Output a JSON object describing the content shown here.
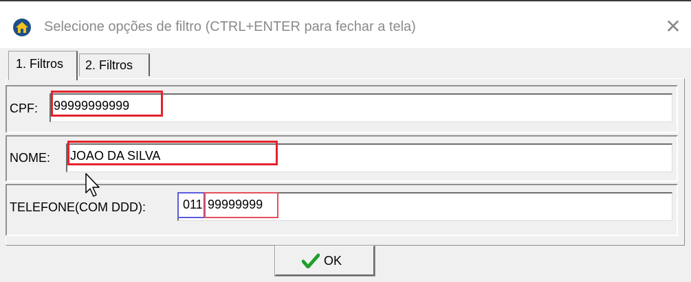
{
  "window": {
    "title": "Selecione opções de filtro (CTRL+ENTER para fechar a tela)",
    "close_glyph": "✕",
    "app_icon": "app-icon"
  },
  "tabs": [
    {
      "label": "1. Filtros",
      "active": true
    },
    {
      "label": "2. Filtros",
      "active": false
    }
  ],
  "fields": {
    "cpf": {
      "label": "CPF:",
      "value": "99999999999"
    },
    "nome": {
      "label": "NOME:",
      "value": "JOAO DA SILVA"
    },
    "telefone": {
      "label": "TELEFONE(COM DDD):",
      "ddd": "011",
      "number": "99999999"
    }
  },
  "buttons": {
    "ok_label": "OK",
    "ok_icon": "check-icon"
  },
  "colors": {
    "highlight_red": "#e3222b",
    "highlight_blue": "#5a5adc",
    "check_green": "#1f9e2b"
  }
}
